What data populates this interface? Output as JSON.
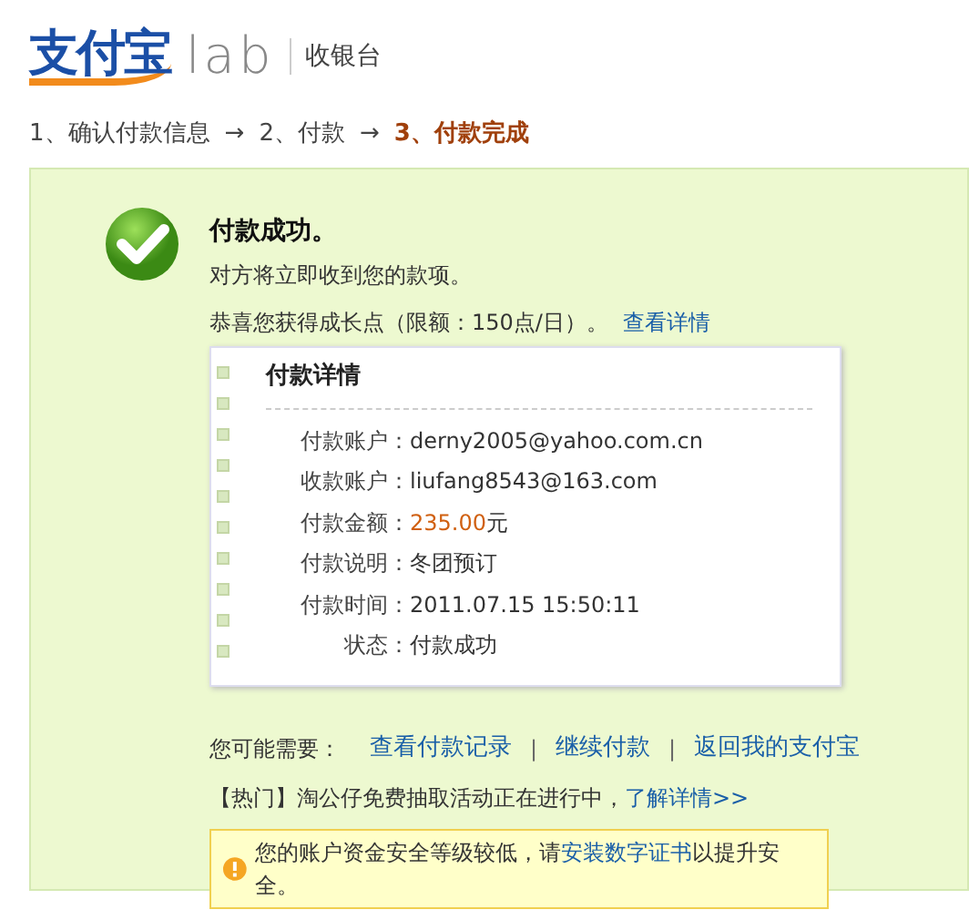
{
  "header": {
    "logo_text": "支付宝",
    "lab_text": "lab",
    "title": "收银台"
  },
  "steps": [
    {
      "label": "1、确认付款信息",
      "selected": false
    },
    {
      "label": "2、付款",
      "selected": false
    },
    {
      "label": "3、付款完成",
      "selected": true
    }
  ],
  "step_arrows": [
    "→",
    "→"
  ],
  "result": {
    "title": "付款成功。",
    "message": "对方将立即收到您的款项。",
    "points_text": "恭喜您获得成长点（限额：150点/日）。",
    "points_link": "查看详情"
  },
  "details": {
    "title": "付款详情",
    "rows": [
      {
        "label": "付款账户：",
        "value": "derny2005@yahoo.com.cn",
        "kind": "plain"
      },
      {
        "label": "收款账户：",
        "value": "liufang8543@163.com",
        "kind": "plain"
      },
      {
        "label": "付款金额：",
        "value": "235.00",
        "unit": "元",
        "kind": "amount"
      },
      {
        "label": "付款说明：",
        "value": "冬团预订",
        "kind": "plain"
      },
      {
        "label": "付款时间：",
        "value": "2011.07.15 15:50:11",
        "kind": "plain"
      },
      {
        "label": "状态：",
        "value": "付款成功",
        "kind": "plain"
      }
    ]
  },
  "next_steps": {
    "label": "您可能需要：",
    "links": [
      "查看付款记录",
      "继续付款",
      "返回我的支付宝"
    ],
    "separators": [
      "|",
      "|"
    ]
  },
  "promo": {
    "text": "【热门】淘公仔免费抽取活动正在进行中，",
    "link": "了解详情>>"
  },
  "warning": {
    "before": "您的账户资金安全等级较低，请",
    "link": "安装数字证书",
    "after": "以提升安全。"
  }
}
